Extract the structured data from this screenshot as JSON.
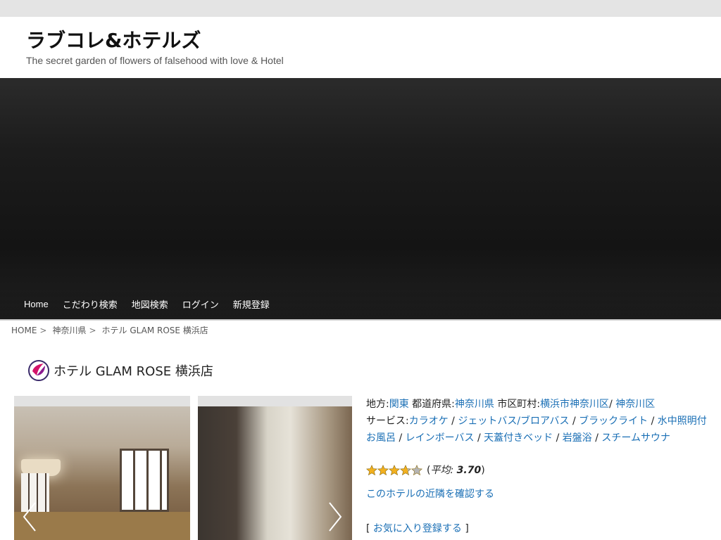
{
  "site": {
    "title": "ラブコレ&ホテルズ",
    "tagline": "The secret garden of flowers of falsehood with love & Hotel"
  },
  "nav": {
    "items": [
      "Home",
      "こだわり検索",
      "地図検索",
      "ログイン",
      "新規登録"
    ]
  },
  "breadcrumb": {
    "home": "HOME",
    "prefecture": "神奈川県",
    "current": "ホテル GLAM ROSE 横浜店",
    "separator": ">"
  },
  "hotel": {
    "name": "ホテル GLAM ROSE 横浜店",
    "region_label": "地方:",
    "region": "関東",
    "prefecture_label": "都道府県:",
    "prefecture": "神奈川県",
    "city_label": "市区町村:",
    "city": "横浜市神奈川区",
    "city_sep": "/",
    "ward": "神奈川区",
    "services_label": "サービス:",
    "services": [
      "カラオケ",
      "ジェットバス/ブロアバス",
      "ブラックライト",
      "水中照明付お風呂",
      "レインボーバス",
      "天蓋付きベッド",
      "岩盤浴",
      "スチームサウナ"
    ],
    "service_sep": "/",
    "rating": {
      "value": 3.7,
      "max": 5,
      "open": "(",
      "avg_label": "平均:",
      "avg_value": "3.70",
      "close": ")"
    },
    "nearby_link": "このホテルの近隣を確認する",
    "favorite": {
      "open": "[",
      "label": "お気に入り登録する",
      "close": "]"
    }
  },
  "colors": {
    "link": "#1a6fb5",
    "topbar": "#e4e4e4",
    "hero": "#1a1a1a",
    "star": "#f2b01e"
  }
}
